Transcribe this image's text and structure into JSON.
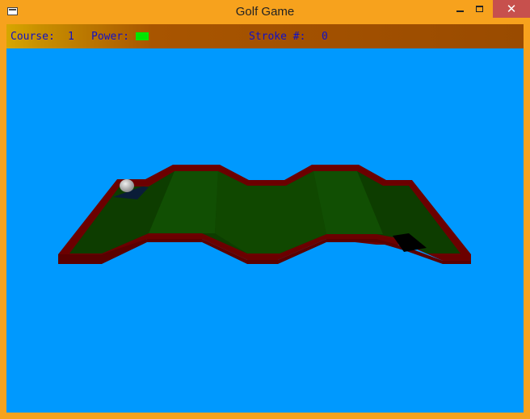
{
  "window": {
    "title": "Golf Game"
  },
  "hud": {
    "course_label": "Course:",
    "course_value": "1",
    "power_label": "Power:",
    "stroke_label": "Stroke #:",
    "stroke_value": "0"
  },
  "colors": {
    "sky": "#0099fe",
    "fairway": "#0d3d00",
    "fairway_light": "#114f03",
    "wall": "#6b0000",
    "power_fill": "#00e600",
    "hud_text": "#1010c8",
    "window_frame": "#f7a21d"
  }
}
